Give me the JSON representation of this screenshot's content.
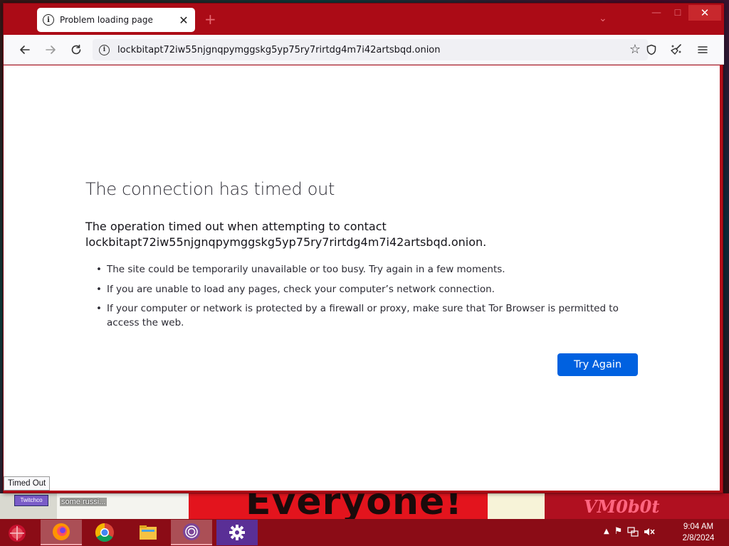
{
  "tab": {
    "title": "Problem loading page"
  },
  "urlbar": {
    "url": "lockbitapt72iw55njgnqpymggskg5yp75ry7rirtdg4m7i42artsbqd.onion"
  },
  "error_page": {
    "title": "The connection has timed out",
    "description_line1": "The operation timed out when attempting to contact",
    "description_line2": "lockbitapt72iw55njgnqpymggskg5yp75ry7rirtdg4m7i42artsbqd.onion.",
    "bullets": [
      "The site could be temporarily unavailable or too busy. Try again in a few moments.",
      "If you are unable to load any pages, check your computer’s network connection.",
      "If your computer or network is protected by a firewall or proxy, make sure that Tor Browser is permitted to access the web."
    ],
    "try_again_label": "Try Again"
  },
  "status_bar": {
    "text": "Timed Out"
  },
  "desktop": {
    "wallpaper_text": "Everyone!",
    "icon_label": "some russi...",
    "tag_text": "Twitchco",
    "corner_text": "VM0b0t"
  },
  "taskbar": {
    "apps": [
      "firefox-icon",
      "chrome-icon",
      "file-explorer-icon",
      "tor-browser-icon",
      "settings-icon"
    ],
    "time": "9:04 AM",
    "date": "2/8/2024"
  },
  "colors": {
    "window_frame": "#ab0b16",
    "taskbar": "#8b0c16",
    "accent_button": "#0061e0"
  }
}
